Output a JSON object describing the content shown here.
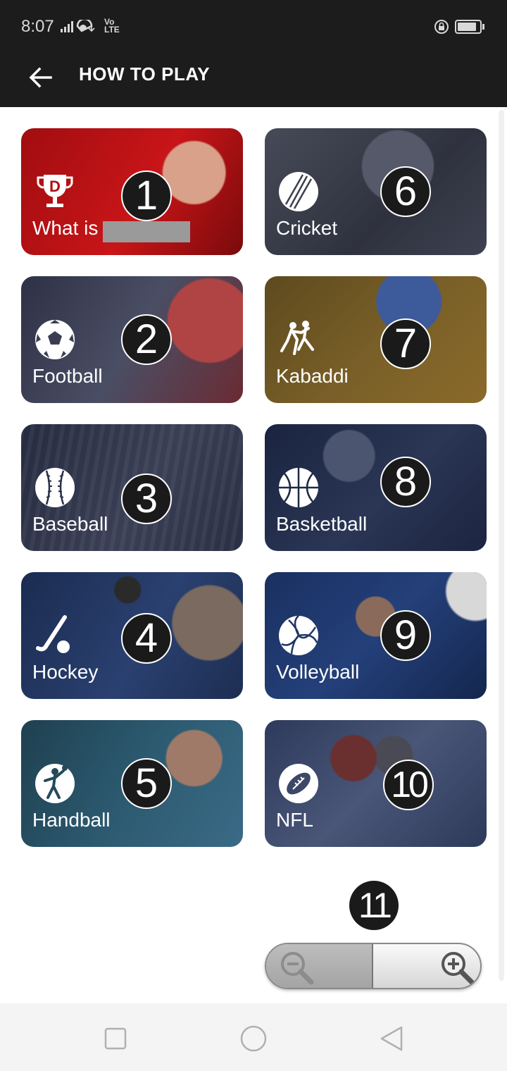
{
  "status_bar": {
    "time": "8:07",
    "network_label": "Vo\nLTE"
  },
  "app_bar": {
    "title": "HOW TO PLAY",
    "back_icon": "arrow-left-icon"
  },
  "cards": [
    {
      "label": "What is ",
      "badge": "1",
      "icon": "dream11-trophy-icon",
      "color": "#b00e12"
    },
    {
      "label": "Cricket",
      "badge": "6",
      "icon": "cricket-ball-icon",
      "color": "#3c3f4d"
    },
    {
      "label": "Football",
      "badge": "2",
      "icon": "football-icon",
      "color": "#3a3d52"
    },
    {
      "label": "Kabaddi",
      "badge": "7",
      "icon": "kabaddi-icon",
      "color": "#6a5322"
    },
    {
      "label": "Baseball",
      "badge": "3",
      "icon": "baseball-icon",
      "color": "#2b3148"
    },
    {
      "label": "Basketball",
      "badge": "8",
      "icon": "basketball-icon",
      "color": "#1e2a45"
    },
    {
      "label": "Hockey",
      "badge": "4",
      "icon": "hockey-icon",
      "color": "#1f3156"
    },
    {
      "label": "Volleyball",
      "badge": "9",
      "icon": "volleyball-icon",
      "color": "#1e3566"
    },
    {
      "label": "Handball",
      "badge": "5",
      "icon": "handball-icon",
      "color": "#244a5a"
    },
    {
      "label": "NFL",
      "badge": "10",
      "icon": "american-football-icon",
      "color": "#3d4766"
    }
  ],
  "overlay": {
    "badge_11": "11",
    "zoom_out_icon": "zoom-out-icon",
    "zoom_in_icon": "zoom-in-icon"
  },
  "nav_bar": {
    "recents_icon": "square-icon",
    "home_icon": "circle-icon",
    "back_icon": "triangle-back-icon"
  }
}
